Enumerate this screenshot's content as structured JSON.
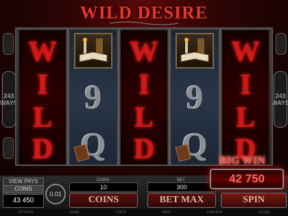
{
  "game": {
    "title": "WILD DESIRE"
  },
  "side_panel": {
    "left": [
      "243",
      "WAYS"
    ],
    "right": [
      "243",
      "WAYS"
    ]
  },
  "reels": {
    "wild_letters": [
      "W",
      "I",
      "L",
      "D"
    ],
    "middle_symbols": [
      "9",
      "Q"
    ]
  },
  "big_win": {
    "label": "BIG WIN",
    "amount": "42 750"
  },
  "controls": {
    "view_pays": "VIEW PAYS",
    "coins_label": "COINS",
    "coins_value": "43 450",
    "coin_size": "0.01",
    "coins_small_label": "COINS",
    "coins_bet_value": "10",
    "bet_small_label": "BET",
    "bet_value": "300",
    "coins_button": "COINS",
    "bet_max_button": "BET MAX",
    "spin_button": "SPIN"
  },
  "footer": [
    "OPTIONS",
    "GAME",
    "STATS",
    "HELP",
    "CASHIER",
    "CLOSE"
  ]
}
